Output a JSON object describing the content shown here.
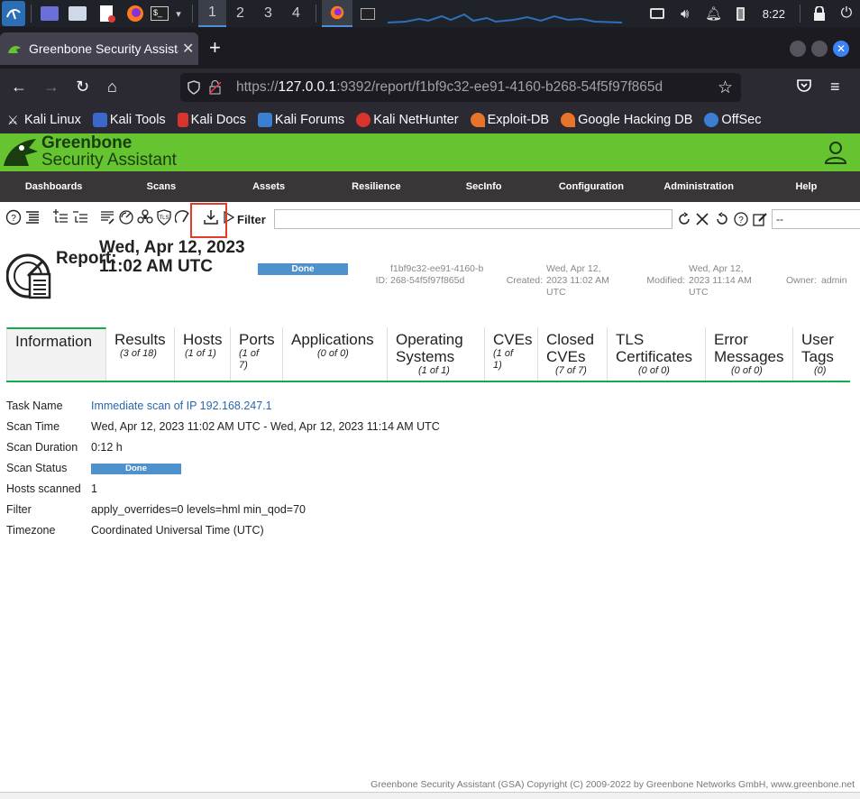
{
  "taskbar": {
    "workspaces": [
      "1",
      "2",
      "3",
      "4"
    ],
    "clock": "8:22"
  },
  "browser": {
    "tab_title": "Greenbone Security Assistant",
    "url_prefix": "https://",
    "url_host": "127.0.0.1",
    "url_rest": ":9392/report/f1bf9c32-ee91-4160-b268-54f5f97f865d",
    "bookmarks": [
      {
        "label": "Kali Linux",
        "color": "#4a90d9"
      },
      {
        "label": "Kali Tools",
        "color": "#e0563b"
      },
      {
        "label": "Kali Docs",
        "color": "#d9342b"
      },
      {
        "label": "Kali Forums",
        "color": "#3a7fd1"
      },
      {
        "label": "Kali NetHunter",
        "color": "#d9342b"
      },
      {
        "label": "Exploit-DB",
        "color": "#e8742a"
      },
      {
        "label": "Google Hacking DB",
        "color": "#e8742a"
      },
      {
        "label": "OffSec",
        "color": "#3a7fd1"
      }
    ]
  },
  "gsa": {
    "logo_line1": "Greenbone",
    "logo_line2": "Security Assistant",
    "menu": [
      "Dashboards",
      "Scans",
      "Assets",
      "Resilience",
      "SecInfo",
      "Configuration",
      "Administration",
      "Help"
    ],
    "filter_label": "Filter",
    "filter_value": "",
    "filter_select": "--"
  },
  "report": {
    "label": "Report:",
    "date": "Wed, Apr 12, 2023 11:02 AM UTC",
    "status": "Done",
    "id_label": "ID:",
    "id_value": "f1bf9c32-ee91-4160-b268-54f5f97f865d",
    "created_label": "Created:",
    "created_value": "Wed, Apr 12, 2023 11:02 AM UTC",
    "modified_label": "Modified:",
    "modified_value": "Wed, Apr 12, 2023 11:14 AM UTC",
    "owner_label": "Owner:",
    "owner_value": "admin"
  },
  "tabs": [
    {
      "title": "Information",
      "count": ""
    },
    {
      "title": "Results",
      "count": "(3 of 18)"
    },
    {
      "title": "Hosts",
      "count": "(1 of 1)"
    },
    {
      "title": "Ports",
      "count": "(1 of 7)"
    },
    {
      "title": "Applications",
      "count": "(0 of 0)"
    },
    {
      "title": "Operating Systems",
      "count": "(1 of 1)"
    },
    {
      "title": "CVEs",
      "count": "(1 of 1)"
    },
    {
      "title": "Closed CVEs",
      "count": "(7 of 7)"
    },
    {
      "title": "TLS Certificates",
      "count": "(0 of 0)"
    },
    {
      "title": "Error Messages",
      "count": "(0 of 0)"
    },
    {
      "title": "User Tags",
      "count": "(0)"
    }
  ],
  "info": {
    "task_name_key": "Task Name",
    "task_name_val": "Immediate scan of IP 192.168.247.1",
    "scan_time_key": "Scan Time",
    "scan_time_val": "Wed, Apr 12, 2023 11:02 AM UTC - Wed, Apr 12, 2023 11:14 AM UTC",
    "scan_duration_key": "Scan Duration",
    "scan_duration_val": "0:12 h",
    "scan_status_key": "Scan Status",
    "scan_status_val": "Done",
    "hosts_scanned_key": "Hosts scanned",
    "hosts_scanned_val": "1",
    "filter_key": "Filter",
    "filter_val": "apply_overrides=0 levels=hml min_qod=70",
    "timezone_key": "Timezone",
    "timezone_val": "Coordinated Universal Time (UTC)"
  },
  "footer": "Greenbone Security Assistant (GSA) Copyright (C) 2009-2022 by Greenbone Networks GmbH, www.greenbone.net"
}
